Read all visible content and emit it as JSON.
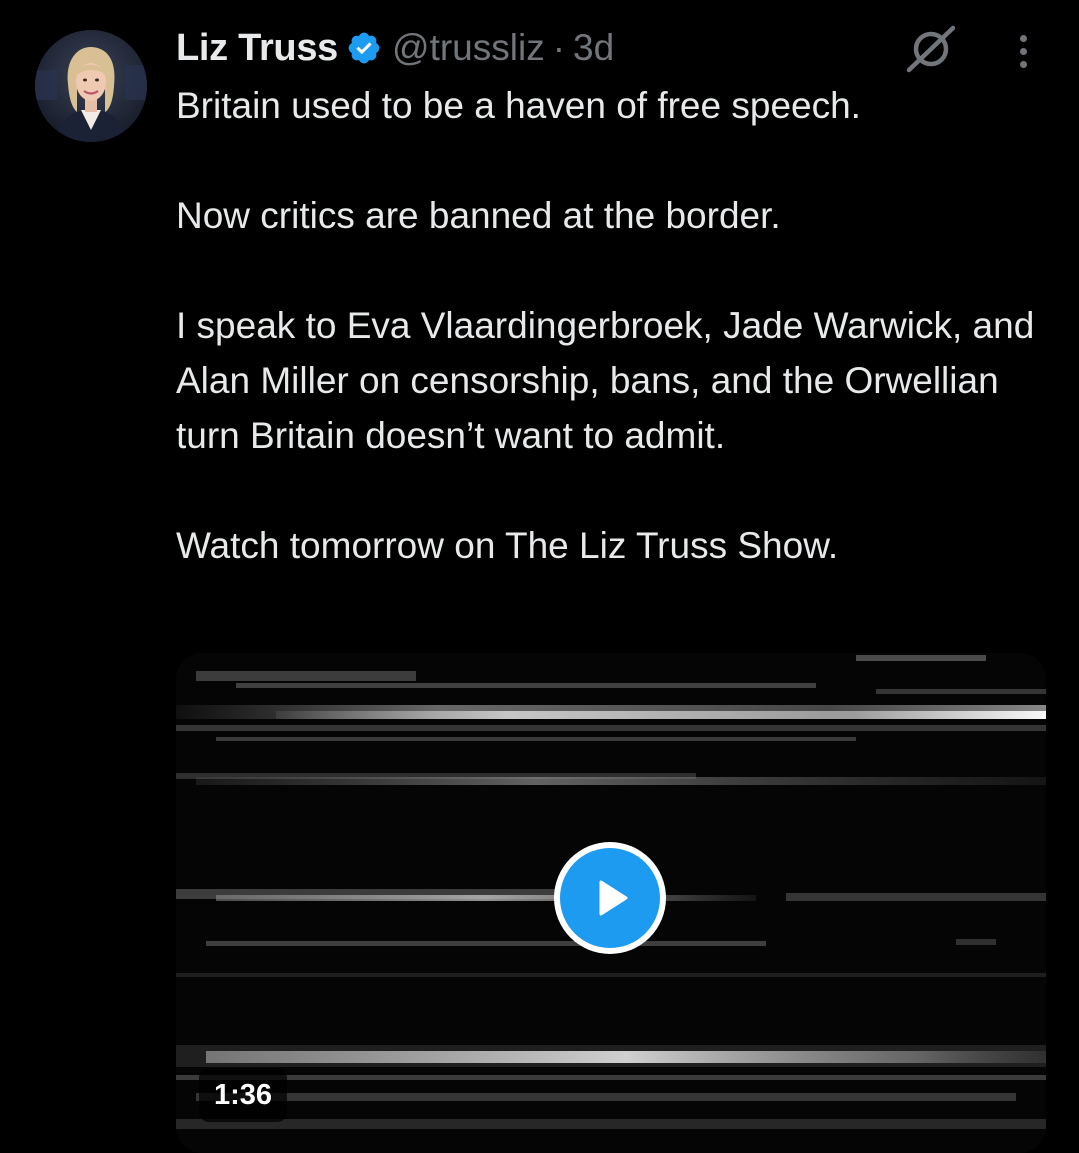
{
  "tweet": {
    "author": {
      "display_name": "Liz Truss",
      "verified_icon": "verified-badge-icon",
      "handle": "@trussliz",
      "separator": "·",
      "time": "3d"
    },
    "actions": {
      "grok_icon": "grok-icon",
      "more_icon": "more-options-icon"
    },
    "paragraphs": [
      "Britain used to be a haven of free speech.",
      "Now critics are banned at the border.",
      "I speak to Eva Vlaardingerbroek, Jade Warwick, and Alan Miller on censorship, bans, and the Orwellian turn Britain doesn’t want to admit.",
      "Watch tomorrow on The Liz Truss Show."
    ],
    "media": {
      "type": "video",
      "duration": "1:36",
      "play_icon": "play-icon"
    }
  },
  "colors": {
    "background": "#000000",
    "text_primary": "#e7e9ea",
    "text_secondary": "#71767b",
    "accent": "#1d9bf0"
  }
}
